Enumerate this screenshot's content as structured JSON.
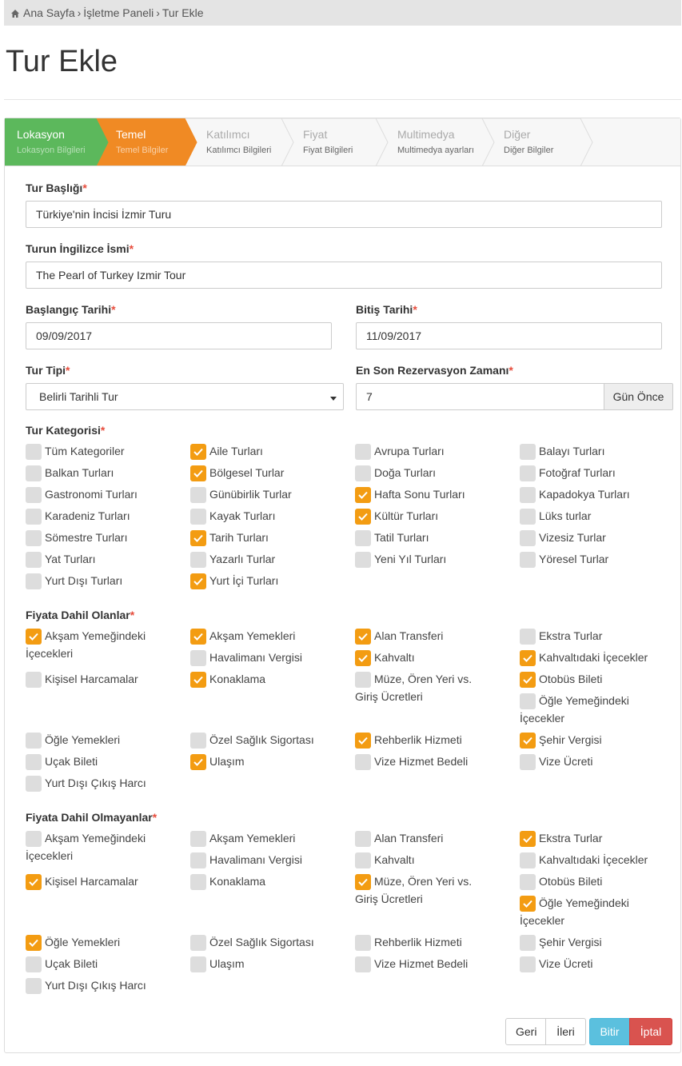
{
  "breadcrumb": {
    "home": "Ana Sayfa",
    "panel": "İşletme Paneli",
    "current": "Tur Ekle"
  },
  "page_title": "Tur Ekle",
  "wizard": [
    {
      "title": "Lokasyon",
      "sub": "Lokasyon Bilgileri",
      "state": "done"
    },
    {
      "title": "Temel",
      "sub": "Temel Bilgiler",
      "state": "active"
    },
    {
      "title": "Katılımcı",
      "sub": "Katılımcı Bilgileri",
      "state": "todo"
    },
    {
      "title": "Fiyat",
      "sub": "Fiyat Bilgileri",
      "state": "todo"
    },
    {
      "title": "Multimedya",
      "sub": "Multimedya ayarları",
      "state": "todo"
    },
    {
      "title": "Diğer",
      "sub": "Diğer Bilgiler",
      "state": "todo"
    }
  ],
  "fields": {
    "title_label": "Tur Başlığı",
    "title_value": "Türkiye'nin İncisi İzmir Turu",
    "en_label": "Turun İngilizce İsmi",
    "en_value": "The Pearl of Turkey Izmir Tour",
    "start_label": "Başlangıç Tarihi",
    "start_value": "09/09/2017",
    "end_label": "Bitiş Tarihi",
    "end_value": "11/09/2017",
    "type_label": "Tur Tipi",
    "type_value": "Belirli Tarihli Tur",
    "deadline_label": "En Son Rezervasyon Zamanı",
    "deadline_value": "7",
    "deadline_addon": "Gün Önce",
    "req": "*"
  },
  "categories": {
    "label": "Tur Kategorisi",
    "items": [
      {
        "label": "Tüm Kategoriler",
        "checked": false
      },
      {
        "label": "Aile Turları",
        "checked": true
      },
      {
        "label": "Avrupa Turları",
        "checked": false
      },
      {
        "label": "Balayı Turları",
        "checked": false
      },
      {
        "label": "Balkan Turları",
        "checked": false
      },
      {
        "label": "Bölgesel Turlar",
        "checked": true
      },
      {
        "label": "Doğa Turları",
        "checked": false
      },
      {
        "label": "Fotoğraf Turları",
        "checked": false
      },
      {
        "label": "Gastronomi Turları",
        "checked": false
      },
      {
        "label": "Günübirlik Turlar",
        "checked": false
      },
      {
        "label": "Hafta Sonu Turları",
        "checked": true
      },
      {
        "label": "Kapadokya Turları",
        "checked": false
      },
      {
        "label": "Karadeniz Turları",
        "checked": false
      },
      {
        "label": "Kayak Turları",
        "checked": false
      },
      {
        "label": "Kültür Turları",
        "checked": true
      },
      {
        "label": "Lüks turlar",
        "checked": false
      },
      {
        "label": "Sömestre Turları",
        "checked": false
      },
      {
        "label": "Tarih Turları",
        "checked": true
      },
      {
        "label": "Tatil Turları",
        "checked": false
      },
      {
        "label": "Vizesiz Turlar",
        "checked": false
      },
      {
        "label": "Yat Turları",
        "checked": false
      },
      {
        "label": "Yazarlı Turlar",
        "checked": false
      },
      {
        "label": "Yeni Yıl Turları",
        "checked": false
      },
      {
        "label": "Yöresel Turlar",
        "checked": false
      },
      {
        "label": "Yurt Dışı Turları",
        "checked": false
      },
      {
        "label": "Yurt İçi Turları",
        "checked": true
      }
    ]
  },
  "included": {
    "label": "Fiyata Dahil Olanlar",
    "items": [
      {
        "label": "Akşam Yemeğindeki İçecekleri",
        "checked": true
      },
      {
        "label": "Akşam Yemekleri",
        "checked": true
      },
      {
        "label": "Alan Transferi",
        "checked": true
      },
      {
        "label": "Ekstra Turlar",
        "checked": false
      },
      {
        "label": "Havalimanı Vergisi",
        "checked": false
      },
      {
        "label": "Kahvaltı",
        "checked": true
      },
      {
        "label": "Kahvaltıdaki İçecekler",
        "checked": true
      },
      {
        "label": "Kişisel Harcamalar",
        "checked": false
      },
      {
        "label": "Konaklama",
        "checked": true
      },
      {
        "label": "Müze, Ören Yeri vs. Giriş Ücretleri",
        "checked": false
      },
      {
        "label": "Otobüs Bileti",
        "checked": true
      },
      {
        "label": "Öğle Yemeğindeki İçecekler",
        "checked": false
      },
      {
        "label": "Öğle Yemekleri",
        "checked": false
      },
      {
        "label": "Özel Sağlık Sigortası",
        "checked": false
      },
      {
        "label": "Rehberlik Hizmeti",
        "checked": true
      },
      {
        "label": "Şehir Vergisi",
        "checked": true
      },
      {
        "label": "Uçak Bileti",
        "checked": false
      },
      {
        "label": "Ulaşım",
        "checked": true
      },
      {
        "label": "Vize Hizmet Bedeli",
        "checked": false
      },
      {
        "label": "Vize Ücreti",
        "checked": false
      },
      {
        "label": "Yurt Dışı Çıkış Harcı",
        "checked": false
      }
    ]
  },
  "excluded": {
    "label": "Fiyata Dahil Olmayanlar",
    "items": [
      {
        "label": "Akşam Yemeğindeki İçecekleri",
        "checked": false
      },
      {
        "label": "Akşam Yemekleri",
        "checked": false
      },
      {
        "label": "Alan Transferi",
        "checked": false
      },
      {
        "label": "Ekstra Turlar",
        "checked": true
      },
      {
        "label": "Havalimanı Vergisi",
        "checked": false
      },
      {
        "label": "Kahvaltı",
        "checked": false
      },
      {
        "label": "Kahvaltıdaki İçecekler",
        "checked": false
      },
      {
        "label": "Kişisel Harcamalar",
        "checked": true
      },
      {
        "label": "Konaklama",
        "checked": false
      },
      {
        "label": "Müze, Ören Yeri vs. Giriş Ücretleri",
        "checked": true
      },
      {
        "label": "Otobüs Bileti",
        "checked": false
      },
      {
        "label": "Öğle Yemeğindeki İçecekler",
        "checked": true
      },
      {
        "label": "Öğle Yemekleri",
        "checked": true
      },
      {
        "label": "Özel Sağlık Sigortası",
        "checked": false
      },
      {
        "label": "Rehberlik Hizmeti",
        "checked": false
      },
      {
        "label": "Şehir Vergisi",
        "checked": false
      },
      {
        "label": "Uçak Bileti",
        "checked": false
      },
      {
        "label": "Ulaşım",
        "checked": false
      },
      {
        "label": "Vize Hizmet Bedeli",
        "checked": false
      },
      {
        "label": "Vize Ücreti",
        "checked": false
      },
      {
        "label": "Yurt Dışı Çıkış Harcı",
        "checked": false
      }
    ]
  },
  "buttons": {
    "back": "Geri",
    "next": "İleri",
    "finish": "Bitir",
    "cancel": "İptal"
  },
  "colors": {
    "done": "#5cb85c",
    "active": "#f08a24",
    "checked": "#f39c12",
    "finish": "#5bc0de",
    "cancel": "#d9534f"
  }
}
